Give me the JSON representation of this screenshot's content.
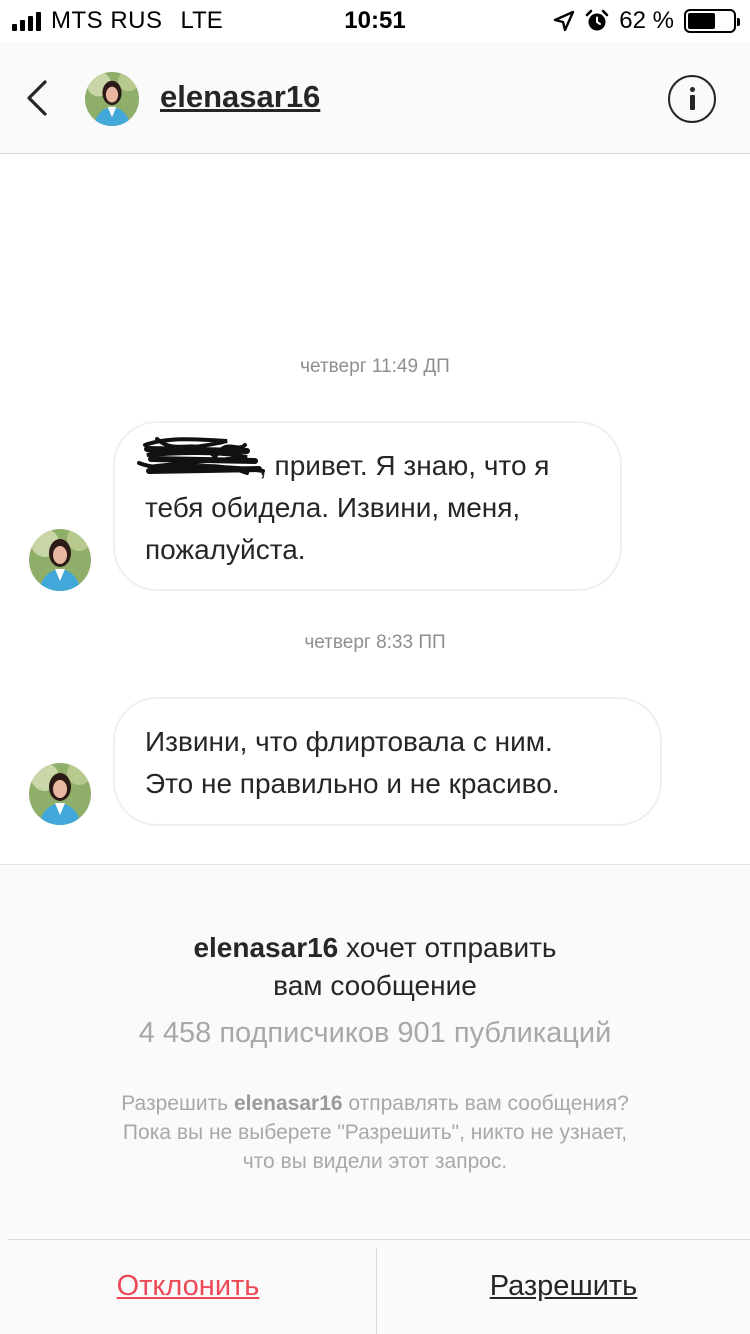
{
  "status_bar": {
    "carrier": "MTS RUS",
    "network": "LTE",
    "time": "10:51",
    "battery_percent": "62 %",
    "battery_level": 0.62
  },
  "header": {
    "username": "elenasar16"
  },
  "messages": [
    {
      "timestamp": "четверг 11:49 ДП",
      "lines": [
        ", привет. Я знаю, что я",
        "тебя обидела. Извини, меня,",
        "пожалуйста."
      ]
    },
    {
      "timestamp": "четверг 8:33 ПП",
      "lines": [
        "Извини, что флиртовала с ним.",
        "Это не правильно и не красиво."
      ]
    }
  ],
  "request": {
    "username": "elenasar16",
    "title_rest": " хочет отправить",
    "title_line2": "вам сообщение",
    "stats": "4 458 подписчиков 901 публикаций",
    "note_prefix": "Разрешить ",
    "note_username": "elenasar16",
    "note_suffix": " отправлять вам сообщения?",
    "note_line2": "Пока вы не выберете \"Разрешить\", никто не узнает,",
    "note_line3": "что вы видели этот запрос."
  },
  "actions": {
    "decline": "Отклонить",
    "allow": "Разрешить"
  },
  "colors": {
    "decline": "#ed4956",
    "avatar_jacket": "#42a8da",
    "avatar_background": "#8fae6a"
  }
}
